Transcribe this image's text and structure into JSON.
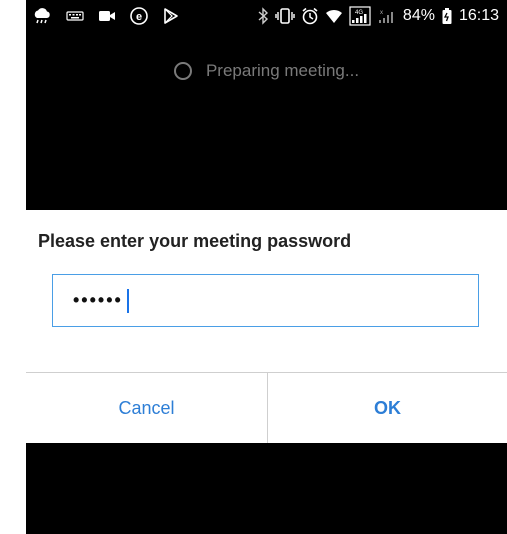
{
  "status_bar": {
    "battery_percent": "84%",
    "time": "16:13",
    "left_icons": [
      "weather-icon",
      "keyboard-icon",
      "video-icon",
      "e-app-icon",
      "play-store-icon"
    ],
    "right_icons": [
      "bluetooth-icon",
      "vibrate-icon",
      "alarm-icon",
      "wifi-icon",
      "signal-4g-icon",
      "signal-no-data-icon",
      "battery-icon"
    ]
  },
  "loading": {
    "text": "Preparing meeting..."
  },
  "dialog": {
    "title": "Please enter your meeting password",
    "password_value": "••••••",
    "cancel_label": "Cancel",
    "ok_label": "OK"
  },
  "colors": {
    "background": "#000000",
    "dialog": "#ffffff",
    "accent": "#2d7ed6",
    "field_border": "#4a9ee6",
    "loading_text": "#7a7a7a"
  }
}
